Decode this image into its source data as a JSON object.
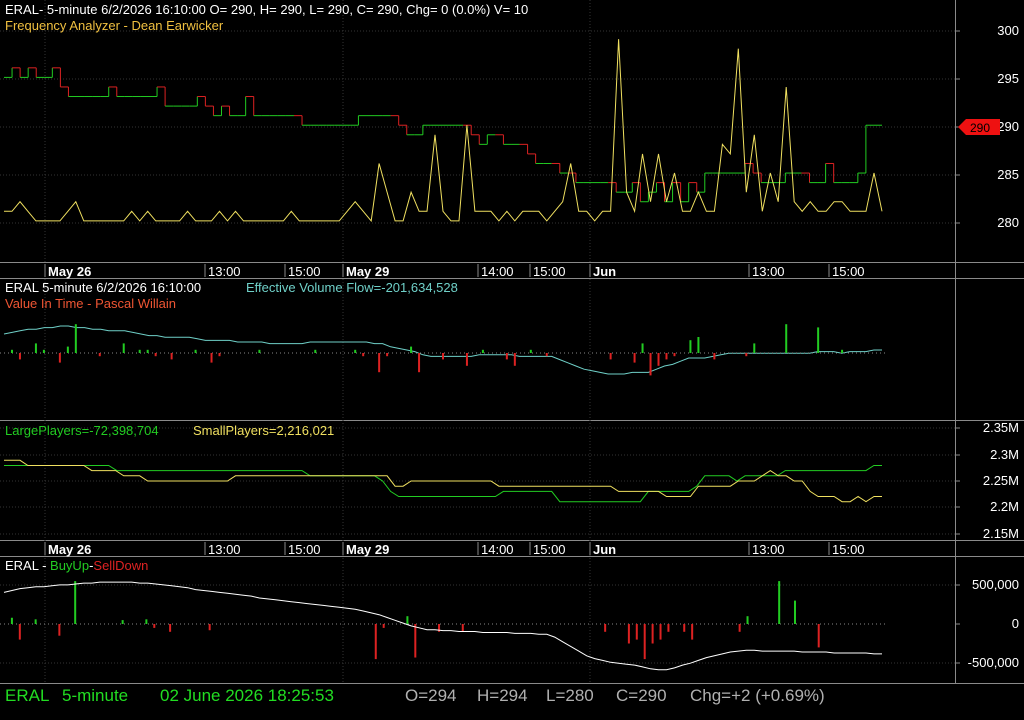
{
  "panel1": {
    "header": "ERAL- 5-minute 6/2/2026 16:10:00 O= 290, H= 290, L= 290, C= 290, Chg= 0 (0.0%) V= 10",
    "indicator_label": "Frequency Analyzer - Dean Earwicker",
    "price_tag": "290",
    "y_ticks": [
      "300",
      "295",
      "290",
      "285",
      "280"
    ]
  },
  "date_axis": {
    "ticks": [
      {
        "label": "May 26",
        "bold": true
      },
      {
        "label": "13:00",
        "bold": false
      },
      {
        "label": "15:00",
        "bold": false
      },
      {
        "label": "May 29",
        "bold": true
      },
      {
        "label": "14:00",
        "bold": false
      },
      {
        "label": "15:00",
        "bold": false
      },
      {
        "label": "Jun",
        "bold": true
      },
      {
        "label": "13:00",
        "bold": false
      },
      {
        "label": "15:00",
        "bold": false
      }
    ]
  },
  "panel2": {
    "title": "ERAL 5-minute  6/2/2026 16:10:00",
    "indicator": "Effective Volume Flow=-201,634,528",
    "indicator2": "Value In Time - Pascal Willain"
  },
  "panel3": {
    "large_players": "LargePlayers=-72,398,704",
    "small_players": "SmallPlayers=2,216,021",
    "y_ticks": [
      "2.35M",
      "2.3M",
      "2.25M",
      "2.2M",
      "2.15M"
    ]
  },
  "panel4": {
    "title": "ERAL - ",
    "buy_up": "BuyUp",
    "dash": "-",
    "sell_down": "SellDown",
    "y_ticks": [
      "500,000",
      "0",
      "-500,000"
    ]
  },
  "status_bar": {
    "symbol": "ERAL",
    "interval": "5-minute",
    "datetime": "02 June 2026 18:25:53",
    "open": "O=294",
    "high": "H=294",
    "low": "L=280",
    "close": "C=290",
    "change": "Chg=+2 (+0.69%)"
  },
  "colors": {
    "up": "#22cc22",
    "down": "#dd2222",
    "oscillator": "#f0e060",
    "flow": "#6fd0c8",
    "price_tag": "#ee1111",
    "status_green": "#22dd22",
    "status_grey": "#b0b0b0"
  },
  "chart_data": {
    "type": "line",
    "price_series": {
      "name": "ERAL",
      "ylim": [
        278,
        301
      ],
      "values": [
        295,
        296,
        295,
        296,
        295,
        295,
        296,
        294,
        293,
        293,
        293,
        293,
        293,
        294,
        293,
        293,
        293,
        293,
        293,
        294,
        292,
        292,
        292,
        292,
        293,
        292,
        291,
        292,
        291,
        291,
        293,
        291,
        291,
        291,
        291,
        291,
        291,
        290,
        290,
        290,
        290,
        290,
        290,
        290,
        291,
        291,
        291,
        291,
        291,
        290,
        289,
        289,
        290,
        290,
        290,
        290,
        290,
        290,
        289,
        288,
        289,
        289,
        288,
        288,
        288,
        287,
        286,
        286,
        286,
        285,
        285,
        284,
        284,
        284,
        284,
        284,
        283,
        283,
        284,
        282,
        283,
        284,
        282,
        284,
        282,
        284,
        283,
        285,
        285,
        285,
        285,
        285,
        286,
        285,
        284,
        284,
        284,
        285,
        285,
        285,
        284,
        284,
        286,
        284,
        284,
        284,
        285,
        290,
        290,
        290
      ]
    },
    "frequency_analyzer": {
      "name": "Frequency Analyzer - Dean Earwicker",
      "ylim": [
        278,
        301
      ],
      "values": [
        281,
        281,
        282,
        281,
        280,
        280,
        280,
        280,
        281,
        282,
        280,
        280,
        280,
        280,
        280,
        280,
        281,
        280,
        281,
        280,
        280,
        280,
        280,
        281,
        280,
        280,
        280,
        281,
        280,
        281,
        280,
        280,
        280,
        280,
        280,
        280,
        281,
        280,
        280,
        280,
        280,
        280,
        280,
        281,
        282,
        281,
        280,
        286,
        283,
        280,
        280,
        283,
        281,
        281,
        289,
        281,
        280,
        280,
        290,
        281,
        281,
        281,
        280,
        281,
        280,
        281,
        281,
        281,
        280,
        281,
        282,
        286,
        281,
        281,
        280,
        281,
        281,
        299,
        283,
        281,
        287,
        282,
        287,
        282,
        285,
        281,
        281,
        283,
        281,
        281,
        288,
        287,
        298,
        283,
        289,
        281,
        285,
        282,
        294,
        282,
        281,
        282,
        281,
        281,
        282,
        282,
        281,
        281,
        281,
        285,
        281
      ]
    },
    "effective_volume_flow": {
      "name": "Effective Volume Flow",
      "values": [
        -201.5,
        -201.4,
        -201.3,
        -201.2,
        -201.2,
        -201.1,
        -201.1,
        -201.0,
        -201.0,
        -201.1,
        -201.1,
        -201.2,
        -201.2,
        -201.3,
        -201.3,
        -201.3,
        -201.4,
        -201.5,
        -201.6,
        -201.6,
        -201.7,
        -201.7,
        -201.7,
        -201.7,
        -201.8,
        -201.9,
        -201.9,
        -201.9,
        -201.9,
        -202.0,
        -202.0,
        -202.0,
        -202.0,
        -202.1,
        -202.1,
        -202.1,
        -202.1,
        -202.1,
        -202.0,
        -202.0,
        -202.0,
        -202.0,
        -202.0,
        -202.0,
        -202.0,
        -202.0,
        -202.1,
        -202.1,
        -202.3,
        -202.4,
        -202.5,
        -202.6,
        -202.8,
        -202.9,
        -202.9,
        -202.9,
        -202.9,
        -202.9,
        -202.9,
        -202.8,
        -202.8,
        -202.8,
        -202.8,
        -202.8,
        -202.9,
        -202.9,
        -202.9,
        -202.9,
        -202.9,
        -203.1,
        -203.3,
        -203.5,
        -203.7,
        -203.8,
        -203.9,
        -204.0,
        -204.0,
        -204.0,
        -203.9,
        -203.9,
        -203.9,
        -203.7,
        -203.5,
        -203.4,
        -203.2,
        -203.0,
        -203.0,
        -203.0,
        -202.9,
        -202.8,
        -202.7,
        -202.7,
        -202.7,
        -202.7,
        -202.7,
        -202.7,
        -202.7,
        -202.7,
        -202.7,
        -202.7,
        -202.7,
        -202.6,
        -202.6,
        -202.6,
        -202.7,
        -202.6,
        -202.6,
        -202.6,
        -202.5,
        -202.5
      ]
    },
    "value_in_time_bars": [
      0,
      0.1,
      -0.2,
      0,
      0.3,
      0.1,
      0,
      -0.3,
      0.2,
      0.9,
      0,
      0,
      -0.1,
      0,
      0,
      0.3,
      0,
      0.1,
      0.1,
      -0.1,
      0,
      -0.2,
      0,
      0,
      0.1,
      0,
      -0.3,
      -0.1,
      0,
      0,
      0,
      0,
      0.1,
      0,
      0,
      0,
      0,
      0,
      0,
      0.1,
      0,
      0,
      0,
      0,
      0.1,
      -0.1,
      0,
      -0.6,
      -0.1,
      0,
      0,
      0.2,
      -0.6,
      0,
      0,
      -0.2,
      0,
      0,
      -0.4,
      0,
      0.1,
      0,
      0,
      -0.2,
      -0.4,
      0,
      0.1,
      0,
      -0.1,
      0,
      0,
      0,
      0,
      0,
      0,
      0,
      -0.2,
      0,
      0,
      -0.3,
      0.3,
      -0.7,
      -0.4,
      -0.2,
      -0.1,
      0,
      0.4,
      0.5,
      0,
      -0.2,
      0,
      0,
      0,
      -0.1,
      0.3,
      0,
      0,
      0,
      0.9,
      0,
      0,
      0,
      0.8,
      0,
      0,
      0.1,
      0,
      0,
      0,
      0,
      0
    ],
    "large_players": {
      "name": "LargePlayers",
      "ylim": [
        2.14,
        2.36
      ],
      "values": [
        2.28,
        2.28,
        2.28,
        2.28,
        2.28,
        2.28,
        2.28,
        2.28,
        2.28,
        2.28,
        2.28,
        2.28,
        2.28,
        2.28,
        2.27,
        2.27,
        2.27,
        2.27,
        2.27,
        2.27,
        2.27,
        2.27,
        2.27,
        2.27,
        2.27,
        2.27,
        2.27,
        2.27,
        2.27,
        2.27,
        2.27,
        2.27,
        2.27,
        2.27,
        2.27,
        2.27,
        2.27,
        2.27,
        2.26,
        2.26,
        2.26,
        2.26,
        2.26,
        2.26,
        2.26,
        2.26,
        2.26,
        2.25,
        2.23,
        2.22,
        2.22,
        2.22,
        2.22,
        2.22,
        2.22,
        2.22,
        2.22,
        2.22,
        2.22,
        2.22,
        2.22,
        2.22,
        2.23,
        2.23,
        2.23,
        2.23,
        2.23,
        2.23,
        2.23,
        2.21,
        2.21,
        2.21,
        2.21,
        2.21,
        2.21,
        2.21,
        2.21,
        2.21,
        2.21,
        2.21,
        2.23,
        2.23,
        2.23,
        2.23,
        2.23,
        2.23,
        2.24,
        2.26,
        2.26,
        2.26,
        2.26,
        2.25,
        2.26,
        2.26,
        2.26,
        2.26,
        2.26,
        2.27,
        2.27,
        2.27,
        2.27,
        2.27,
        2.27,
        2.27,
        2.27,
        2.27,
        2.27,
        2.27,
        2.28,
        2.28
      ]
    },
    "small_players": {
      "name": "SmallPlayers",
      "ylim": [
        2.14,
        2.36
      ],
      "values": [
        2.29,
        2.29,
        2.29,
        2.28,
        2.28,
        2.28,
        2.28,
        2.28,
        2.28,
        2.28,
        2.28,
        2.27,
        2.27,
        2.27,
        2.27,
        2.26,
        2.26,
        2.26,
        2.25,
        2.25,
        2.25,
        2.25,
        2.25,
        2.25,
        2.25,
        2.25,
        2.25,
        2.25,
        2.25,
        2.26,
        2.26,
        2.26,
        2.26,
        2.26,
        2.26,
        2.26,
        2.26,
        2.26,
        2.26,
        2.26,
        2.26,
        2.26,
        2.26,
        2.26,
        2.26,
        2.26,
        2.26,
        2.26,
        2.26,
        2.24,
        2.24,
        2.25,
        2.25,
        2.25,
        2.25,
        2.25,
        2.25,
        2.25,
        2.25,
        2.25,
        2.25,
        2.25,
        2.24,
        2.24,
        2.24,
        2.24,
        2.24,
        2.24,
        2.24,
        2.24,
        2.24,
        2.24,
        2.24,
        2.24,
        2.24,
        2.24,
        2.24,
        2.23,
        2.23,
        2.23,
        2.23,
        2.23,
        2.23,
        2.22,
        2.22,
        2.22,
        2.22,
        2.24,
        2.24,
        2.24,
        2.24,
        2.24,
        2.25,
        2.25,
        2.25,
        2.26,
        2.27,
        2.26,
        2.26,
        2.25,
        2.25,
        2.23,
        2.22,
        2.22,
        2.22,
        2.21,
        2.21,
        2.22,
        2.21,
        2.22,
        2.22
      ]
    },
    "buyup_selldown": {
      "name": "BuyUp-SellDown",
      "ylim": [
        -560000,
        620000
      ],
      "line": [
        380000,
        400000,
        420000,
        430000,
        440000,
        440000,
        450000,
        460000,
        460000,
        470000,
        480000,
        480000,
        490000,
        490000,
        490000,
        490000,
        490000,
        480000,
        480000,
        470000,
        460000,
        450000,
        440000,
        430000,
        410000,
        400000,
        390000,
        380000,
        370000,
        360000,
        350000,
        340000,
        320000,
        310000,
        300000,
        290000,
        280000,
        270000,
        260000,
        250000,
        240000,
        230000,
        220000,
        210000,
        200000,
        180000,
        160000,
        140000,
        110000,
        80000,
        50000,
        20000,
        0,
        -20000,
        -20000,
        -30000,
        -30000,
        -40000,
        -40000,
        -40000,
        -50000,
        -50000,
        -50000,
        -50000,
        -60000,
        -60000,
        -60000,
        -70000,
        -70000,
        -100000,
        -150000,
        -200000,
        -250000,
        -300000,
        -330000,
        -350000,
        -370000,
        -380000,
        -390000,
        -400000,
        -420000,
        -440000,
        -450000,
        -450000,
        -430000,
        -400000,
        -380000,
        -350000,
        -320000,
        -300000,
        -280000,
        -260000,
        -250000,
        -240000,
        -240000,
        -250000,
        -250000,
        -250000,
        -250000,
        -250000,
        -260000,
        -260000,
        -260000,
        -260000,
        -270000,
        -270000,
        -270000,
        -270000,
        -270000,
        -280000,
        -280000
      ],
      "bars": [
        0,
        80000,
        -200000,
        0,
        60000,
        0,
        0,
        -150000,
        0,
        550000,
        0,
        0,
        0,
        0,
        0,
        50000,
        0,
        0,
        60000,
        -50000,
        0,
        -100000,
        0,
        0,
        0,
        0,
        -80000,
        0,
        0,
        0,
        0,
        0,
        0,
        0,
        0,
        0,
        0,
        0,
        0,
        0,
        0,
        0,
        0,
        0,
        0,
        0,
        0,
        -450000,
        -50000,
        0,
        0,
        100000,
        -430000,
        0,
        0,
        -100000,
        0,
        0,
        -100000,
        0,
        0,
        0,
        0,
        0,
        0,
        0,
        0,
        0,
        0,
        0,
        0,
        0,
        0,
        0,
        0,
        0,
        -100000,
        0,
        0,
        -250000,
        -200000,
        -450000,
        -250000,
        -200000,
        -100000,
        0,
        -100000,
        -200000,
        0,
        0,
        0,
        0,
        0,
        -100000,
        100000,
        0,
        0,
        0,
        550000,
        0,
        300000,
        0,
        0,
        -300000,
        0,
        0,
        0,
        0,
        0,
        0,
        0,
        0
      ]
    }
  }
}
